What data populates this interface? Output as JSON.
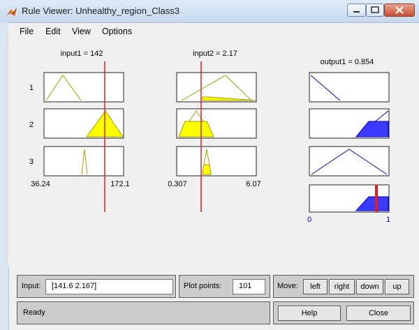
{
  "window": {
    "title": "Rule Viewer: Unhealthy_region_Class3"
  },
  "menu": [
    "File",
    "Edit",
    "View",
    "Options"
  ],
  "inputs": [
    {
      "header": "input1 = 142",
      "range_min": "36.24",
      "range_max": "172.1",
      "current_value": 142
    },
    {
      "header": "input2 = 2.17",
      "range_min": "0.307",
      "range_max": "6.07",
      "current_value": 2.17
    }
  ],
  "output": {
    "header": "output1 = 0.854",
    "range_min": "0",
    "range_max": "1",
    "current_value": 0.854
  },
  "rules": [
    "1",
    "2",
    "3"
  ],
  "controls": {
    "input_label": "Input:",
    "input_value": "[141.6 2.167]",
    "plot_points_label": "Plot points:",
    "plot_points_value": "101",
    "move_label": "Move:",
    "move_buttons": [
      "left",
      "right",
      "down",
      "up"
    ],
    "status": "Ready",
    "help_label": "Help",
    "close_label": "Close"
  },
  "colors": {
    "input_mf_fill": "#ffff00",
    "input_mf_line": "#a0a000",
    "output_mf_fill": "#3b3bff",
    "output_mf_line": "#0000cc",
    "index_line": "#e02020"
  }
}
